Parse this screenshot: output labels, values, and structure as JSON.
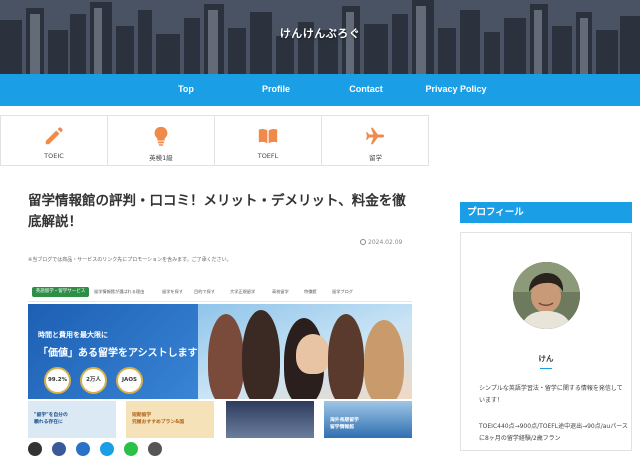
{
  "site": {
    "title": "けんけんぶろぐ"
  },
  "nav": {
    "items": [
      "Top",
      "Profile",
      "Contact",
      "Privacy Policy"
    ]
  },
  "icon_menu": {
    "items": [
      {
        "label": "TOEIC",
        "icon": "pencil-icon"
      },
      {
        "label": "英検1級",
        "icon": "lightbulb-icon"
      },
      {
        "label": "TOEFL",
        "icon": "book-icon"
      },
      {
        "label": "留学",
        "icon": "airplane-icon"
      }
    ]
  },
  "article": {
    "title": "留学情報館の評判・口コミ！メリット・デメリット、料金を徹底解説！",
    "date": "2024.02.09",
    "promo_note": "※当ブログでは商品・サービスのリンク先にプロモーションを含みます。ご了承ください。"
  },
  "eyecatch": {
    "badge": "英語留学・留学サービス",
    "nav_items": [
      "留学情報館が選ばれる理由",
      "留学を探す",
      "目的で探す",
      "大学正規留学",
      "高校留学",
      "特徴館",
      "留学ブログ"
    ],
    "headline_small": "時間と費用を最大限に",
    "headline_large": "「価値」ある留学をアシストします",
    "badges": [
      "99.2%",
      "2万人",
      "JAOS"
    ],
    "tiles": [
      "\"留学\"を自分の\n頼れる存在に",
      "短期留学\n究極おすすめプラン&国",
      "",
      "海外長期留学\n留学情報館"
    ]
  },
  "sidebar": {
    "heading": "プロフィール",
    "name": "けん",
    "bio": "シンプルな英語学習法・留学に関する情報を発信しています！",
    "bio2": "TOEIC440点→900点/TOEFL途中退出→90点/auパースに8ヶ月の留学経験/2歳フラン"
  },
  "colors": {
    "accent": "#1a9fe6",
    "icon_orange": "#f08a4b"
  }
}
